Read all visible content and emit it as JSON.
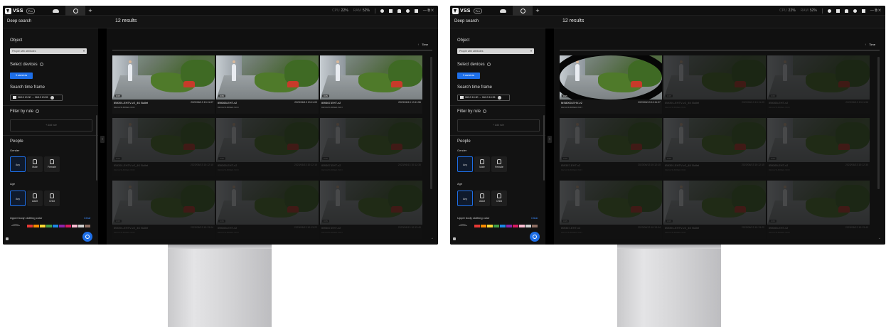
{
  "app": {
    "logo_text": "VSS",
    "logo_badge": "Pro",
    "stats": [
      {
        "prefix": "CPU",
        "value": "22%"
      },
      {
        "prefix": "RAM",
        "value": "52%"
      }
    ],
    "topbar_right_text": "— ⧉ ✕"
  },
  "header": {
    "title": "Deep search",
    "results": "12 results"
  },
  "sidebar": {
    "object_label": "Object",
    "object_value": "People with attributes",
    "devices_label": "Select devices",
    "devices_button": "3 cameras",
    "timeframe_label": "Search time frame",
    "timeframe_value": "06/13 10:30 → 06/13 10:35",
    "filter_label": "Filter by rule",
    "add_rule": "+ Add rule",
    "people_label": "People",
    "gender_label": "Gender",
    "gender_options": [
      "Any",
      "Male",
      "Female"
    ],
    "age_label": "Age",
    "age_options": [
      "Any",
      "Adult",
      "Child"
    ],
    "upper_label": "Upper body clothing color",
    "clear": "Clear",
    "swatch_colors": [
      "#e53935",
      "#fb8c00",
      "#fdd835",
      "#43a047",
      "#1e88e5",
      "#8e24aa",
      "#d81b60",
      "#f8bbd0",
      "#cfcfcf",
      "#8d6e63"
    ],
    "collapse_glyph": "‹"
  },
  "main": {
    "sort_arrow": "↑",
    "sort_label": "Time",
    "chevron": "⌄"
  },
  "screens": [
    {
      "cards": [
        {
          "name": "IB9391-EHTV-v2_4K Bullet",
          "time": "2023/06/13 10:11:07",
          "sub": "DEVAVR-B9SE0-WIFI",
          "duration": "0:05",
          "dim": false
        },
        {
          "name": "IB9365-EHT-v2",
          "time": "2023/06/13 10:11:09",
          "sub": "DEVAVR-B9SE0-WIFI",
          "duration": "0:05",
          "dim": false
        },
        {
          "name": "IB9367-EHT-v2",
          "time": "2023/06/13 10:11:56",
          "sub": "DEVAVR-B9SE0-WIFI",
          "duration": "0:05",
          "dim": false
        },
        {
          "name": "IB9391-EHTV-v2_4K Bullet",
          "time": "2023/06/13 10:12:10",
          "sub": "DEVAVR-B9SE0-WIFI",
          "duration": "0:05",
          "dim": true
        },
        {
          "name": "IB9365-EHT-v2",
          "time": "2023/06/13 10:12:15",
          "sub": "DEVAVR-B9SE0-WIFI",
          "duration": "0:05",
          "dim": true
        },
        {
          "name": "IB9367-EHT-v2",
          "time": "2023/06/13 10:12:30",
          "sub": "DEVAVR-B9SE0-WIFI",
          "duration": "0:05",
          "dim": true
        },
        {
          "name": "IB9391-EHTV-v2_4K Bullet",
          "time": "2023/06/13 10:13:04",
          "sub": "DEVAVR-B9SE0-WIFI",
          "duration": "0:05",
          "dim": true
        },
        {
          "name": "IB9365-EHT-v2",
          "time": "2023/06/13 10:13:22",
          "sub": "DEVAVR-B9SE0-WIFI",
          "duration": "0:05",
          "dim": true
        },
        {
          "name": "IB9367-EHT-v2",
          "time": "2023/06/13 10:13:40",
          "sub": "DEVAVR-B9SE0-WIFI",
          "duration": "0:05",
          "dim": true
        }
      ]
    },
    {
      "cards": [
        {
          "name": "MS8000-EHV-v2",
          "time": "2023/06/13 10:11:07",
          "sub": "DEVAVR-B9SE0-WIFI",
          "duration": "0:05",
          "dim": false,
          "fisheye": true
        },
        {
          "name": "IB9391-EHTV-v2_4K Bullet",
          "time": "2023/06/13 10:11:09",
          "sub": "DEVAVR-B9SE0-WIFI",
          "duration": "0:05",
          "dim": true
        },
        {
          "name": "IB9365-EHT-v2",
          "time": "2023/06/13 10:11:56",
          "sub": "DEVAVR-B9SE0-WIFI",
          "duration": "0:05",
          "dim": true
        },
        {
          "name": "IB9367-EHT-v2",
          "time": "2023/06/13 10:12:10",
          "sub": "DEVAVR-B9SE0-WIFI",
          "duration": "0:05",
          "dim": true
        },
        {
          "name": "IB9391-EHTV-v2_4K Bullet",
          "time": "2023/06/13 10:12:15",
          "sub": "DEVAVR-B9SE0-WIFI",
          "duration": "0:05",
          "dim": true
        },
        {
          "name": "IB9365-EHT-v2",
          "time": "2023/06/13 10:12:30",
          "sub": "DEVAVR-B9SE0-WIFI",
          "duration": "0:05",
          "dim": true
        },
        {
          "name": "IB9367-EHT-v2",
          "time": "2023/06/13 10:13:04",
          "sub": "DEVAVR-B9SE0-WIFI",
          "duration": "0:05",
          "dim": true
        },
        {
          "name": "IB9391-EHTV-v2_4K Bullet",
          "time": "2023/06/13 10:13:22",
          "sub": "DEVAVR-B9SE0-WIFI",
          "duration": "0:05",
          "dim": true
        },
        {
          "name": "IB9365-EHT-v2",
          "time": "2023/06/13 10:13:40",
          "sub": "DEVAVR-B9SE0-WIFI",
          "duration": "0:05",
          "dim": true
        }
      ]
    }
  ]
}
